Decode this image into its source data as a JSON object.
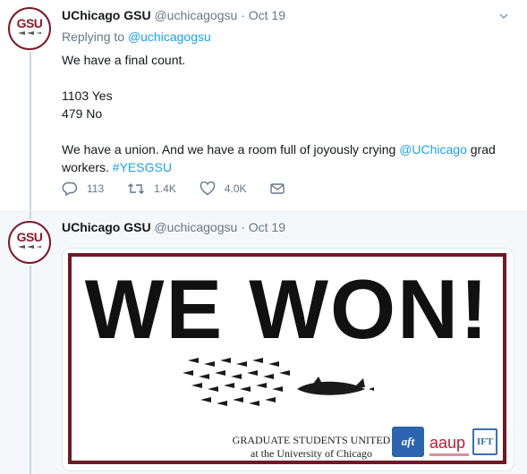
{
  "tweets": [
    {
      "avatar_text": "GSU",
      "name": "UChicago GSU",
      "handle": "@uchicagogsu",
      "separator": "·",
      "time": "Oct 19",
      "reply_prefix": "Replying to",
      "reply_handle": "@uchicagogsu",
      "lines": {
        "l1": "We have a final count.",
        "l2": "1103 Yes",
        "l3": "479 No",
        "l4a": "We have a union. And we have a room full of joyously crying ",
        "l4_mention": "@UChicago",
        "l4b": " grad",
        "l5a": "workers. ",
        "l5_hashtag": "#YESGSU"
      },
      "actions": {
        "replies": "113",
        "retweets": "1.4K",
        "likes": "4.0K"
      }
    },
    {
      "avatar_text": "GSU",
      "name": "UChicago GSU",
      "handle": "@uchicagogsu",
      "separator": "·",
      "time": "Oct 19",
      "poster": {
        "headline": "WE WON!",
        "org_line1": "GRADUATE STUDENTS UNITED",
        "org_line2": "at the University of Chicago",
        "logo_aft": "aft",
        "logo_aaup": "aaup",
        "logo_ift": "IFT"
      }
    }
  ],
  "colors": {
    "link": "#1da1f2",
    "muted": "#657786",
    "maroon": "#6e1a26"
  }
}
